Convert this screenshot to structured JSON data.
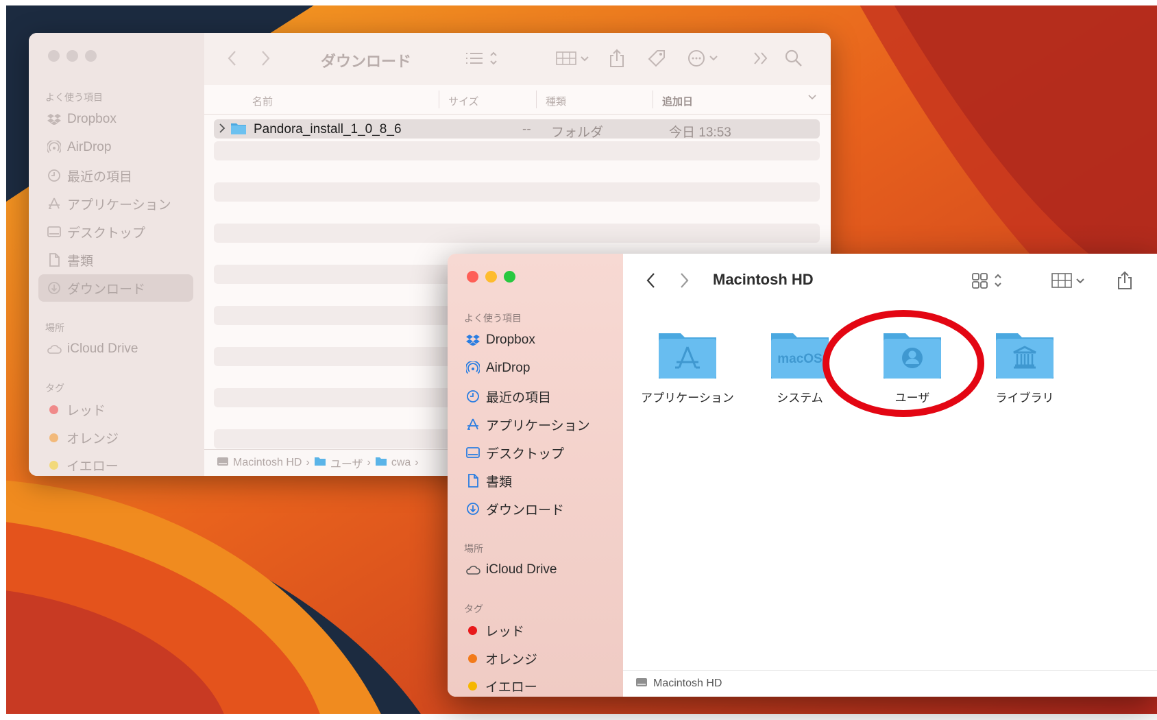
{
  "back_window": {
    "title": "ダウンロード",
    "sidebar": {
      "favorites_heading": "よく使う項目",
      "favorites": [
        {
          "label": "Dropbox",
          "icon": "dropbox-icon"
        },
        {
          "label": "AirDrop",
          "icon": "airdrop-icon"
        },
        {
          "label": "最近の項目",
          "icon": "clock-icon"
        },
        {
          "label": "アプリケーション",
          "icon": "applications-icon"
        },
        {
          "label": "デスクトップ",
          "icon": "desktop-icon"
        },
        {
          "label": "書類",
          "icon": "document-icon"
        },
        {
          "label": "ダウンロード",
          "icon": "download-icon"
        }
      ],
      "locations_heading": "場所",
      "locations": [
        {
          "label": "iCloud Drive",
          "icon": "cloud-icon"
        }
      ],
      "tags_heading": "タグ",
      "tags": [
        {
          "label": "レッド",
          "color": "#f08a8a"
        },
        {
          "label": "オレンジ",
          "color": "#f2b97a"
        },
        {
          "label": "イエロー",
          "color": "#f2d97a"
        }
      ]
    },
    "columns": {
      "name": "名前",
      "size": "サイズ",
      "kind": "種類",
      "date_added": "追加日"
    },
    "rows": [
      {
        "name": "Pandora_install_1_0_8_6",
        "size": "--",
        "kind": "フォルダ",
        "date": "今日 13:53"
      }
    ],
    "path": {
      "disk": "Macintosh HD",
      "sep": "›",
      "users": "ユーザ",
      "user": "cwa"
    }
  },
  "front_window": {
    "title": "Macintosh HD",
    "sidebar": {
      "favorites_heading": "よく使う項目",
      "favorites": [
        {
          "label": "Dropbox",
          "icon": "dropbox-icon"
        },
        {
          "label": "AirDrop",
          "icon": "airdrop-icon"
        },
        {
          "label": "最近の項目",
          "icon": "clock-icon"
        },
        {
          "label": "アプリケーション",
          "icon": "applications-icon"
        },
        {
          "label": "デスクトップ",
          "icon": "desktop-icon"
        },
        {
          "label": "書類",
          "icon": "document-icon"
        },
        {
          "label": "ダウンロード",
          "icon": "download-icon"
        }
      ],
      "locations_heading": "場所",
      "locations": [
        {
          "label": "iCloud Drive",
          "icon": "cloud-icon"
        }
      ],
      "tags_heading": "タグ",
      "tags": [
        {
          "label": "レッド",
          "color": "#e8191b"
        },
        {
          "label": "オレンジ",
          "color": "#f27a1a"
        },
        {
          "label": "イエロー",
          "color": "#f5b700"
        }
      ]
    },
    "folders": [
      {
        "label": "アプリケーション",
        "emblem": "applications"
      },
      {
        "label": "システム",
        "emblem": "macOS"
      },
      {
        "label": "ユーザ",
        "emblem": "user"
      },
      {
        "label": "ライブラリ",
        "emblem": "library"
      }
    ],
    "path": {
      "disk": "Macintosh HD"
    }
  },
  "annotation": {
    "target": "ユーザ",
    "color": "#e30613"
  },
  "colors": {
    "accent": "#2a7de1",
    "folder": "#5ab4e8",
    "highlight_ring": "#e30613"
  }
}
